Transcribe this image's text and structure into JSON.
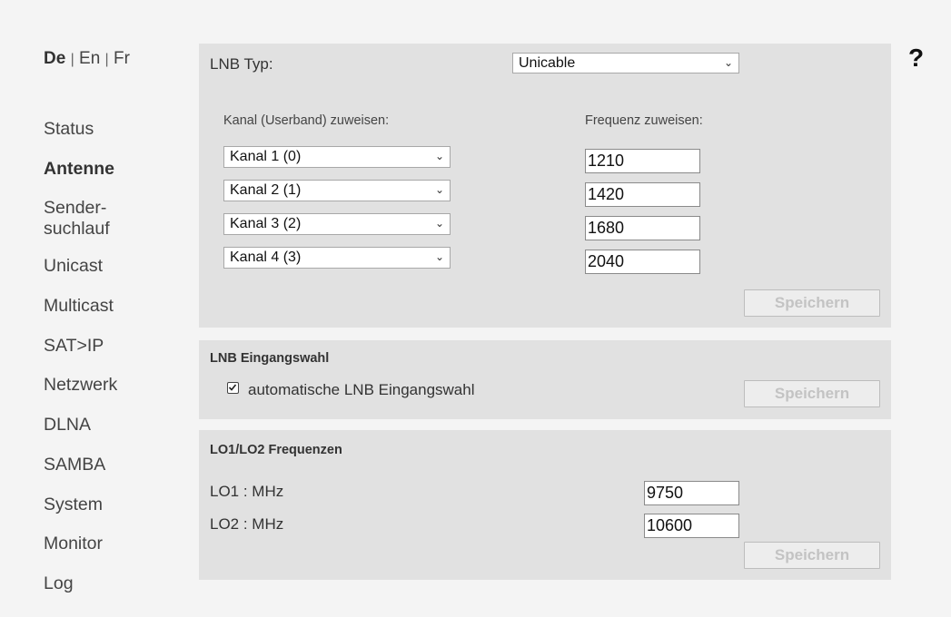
{
  "language": {
    "current": "De",
    "sep1": "|",
    "en": "En",
    "sep2": "|",
    "fr": "Fr"
  },
  "help": {
    "label": "?"
  },
  "nav": {
    "status": "Status",
    "antenne": "Antenne",
    "sender_line1": "Sender-",
    "sender_line2": "suchlauf",
    "unicast": "Unicast",
    "multicast": "Multicast",
    "satip": "SAT>IP",
    "netzwerk": "Netzwerk",
    "dlna": "DLNA",
    "samba": "SAMBA",
    "system": "System",
    "monitor": "Monitor",
    "log": "Log",
    "active": "Antenne"
  },
  "lnb": {
    "type_label": "LNB Typ:",
    "type_value": "Unicable",
    "channel_header": "Kanal (Userband) zuweisen:",
    "freq_header": "Frequenz zuweisen:",
    "channels": [
      {
        "select": "Kanal 1 (0)",
        "freq": "1210"
      },
      {
        "select": "Kanal 2 (1)",
        "freq": "1420"
      },
      {
        "select": "Kanal 3 (2)",
        "freq": "1680"
      },
      {
        "select": "Kanal 4 (3)",
        "freq": "2040"
      }
    ],
    "save": "Speichern"
  },
  "input_select": {
    "title": "LNB Eingangswahl",
    "checkbox_label": "automatische LNB Eingangswahl",
    "checked": true,
    "save": "Speichern"
  },
  "lo": {
    "title": "LO1/LO2 Frequenzen",
    "lo1_label": "LO1 : MHz",
    "lo1_value": "9750",
    "lo2_label": "LO2 : MHz",
    "lo2_value": "10600",
    "save": "Speichern"
  }
}
